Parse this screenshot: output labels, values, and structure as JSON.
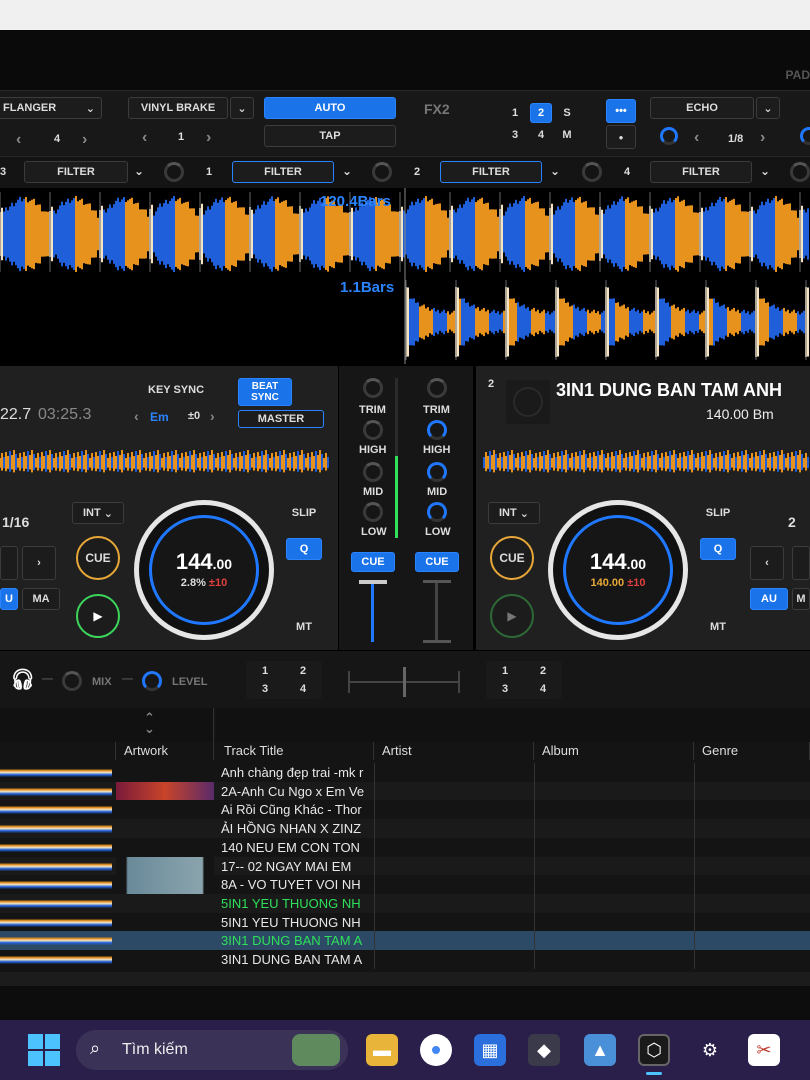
{
  "fx": {
    "fx1_effect": "FLANGER",
    "fx1_value": "4",
    "vinyl_brake": "VINYL BRAKE",
    "vinyl_value": "1",
    "auto": "AUTO",
    "tap": "TAP",
    "fx2_label": "FX2",
    "fx2_ch": [
      "1",
      "2",
      "S",
      "3",
      "4",
      "M"
    ],
    "fx2_more": "•••",
    "fx2_dot": "●",
    "fx2_effect": "ECHO",
    "fx2_value": "1/8",
    "pad_label": "PAD"
  },
  "filters": {
    "ch3_num": "3",
    "ch1_num": "1",
    "ch2_num": "2",
    "ch4_num": "4",
    "label": "FILTER"
  },
  "waveform": {
    "deck1_bars": "120.4Bars",
    "deck2_bars": "1.1Bars"
  },
  "deck1": {
    "elapsed": "22.7",
    "remain": "03:25.3",
    "key_sync": "KEY SYNC",
    "beat_sync": "BEAT SYNC",
    "key": "Em",
    "key_offset": "±0",
    "master": "MASTER",
    "loop": "1/16",
    "int": "INT",
    "slip": "SLIP",
    "q": "Q",
    "cue": "CUE",
    "play": "▶",
    "bpm": "144",
    "bpm_dec": ".00",
    "pitch": "2.8%",
    "range": "±10",
    "mt": "MT",
    "au": "U",
    "ma": "MA"
  },
  "mixer": {
    "trim": "TRIM",
    "high": "HIGH",
    "mid": "MID",
    "low": "LOW",
    "cue": "CUE"
  },
  "deck2": {
    "num": "2",
    "title": "3IN1 DUNG BAN TAM ANH",
    "bpm_key": "140.00 Bm",
    "int": "INT",
    "slip": "SLIP",
    "q": "Q",
    "cue": "CUE",
    "bpm": "144",
    "bpm_dec": ".00",
    "orig_bpm": "140.00",
    "range": "±10",
    "mt": "MT",
    "au": "AU",
    "m": "M",
    "loop": "2"
  },
  "bottom": {
    "mix": "MIX",
    "level": "LEVEL",
    "ch_a": [
      "1",
      "2",
      "3",
      "4"
    ],
    "ch_b": [
      "1",
      "2",
      "3",
      "4"
    ]
  },
  "browser": {
    "columns": [
      "Artwork",
      "Track Title",
      "Artist",
      "Album",
      "Genre"
    ],
    "tracks": [
      "Anh chàng đẹp trai -mk r",
      "2A-Anh Cu Ngo x Em Ve",
      "Ai Rồi Cũng Khác - Thor",
      "ẢI HỒNG NHAN X ZINZ",
      "140 NEU EM CON TON",
      "17-- 02 NGAY MAI EM",
      "8A - VO TUYET VOI NH",
      "5IN1 YEU THUONG NH",
      "5IN1 YEU THUONG NH",
      "3IN1 DUNG BAN TAM A",
      "3IN1 DUNG BAN TAM A"
    ]
  },
  "taskbar": {
    "search_placeholder": "Tìm kiếm"
  },
  "colors": {
    "accent": "#1a73e8",
    "waveform_orange": "#e8921e",
    "waveform_blue": "#1f5fd9",
    "played_green": "#2ee05a",
    "cue_ring": "#e8a838"
  }
}
